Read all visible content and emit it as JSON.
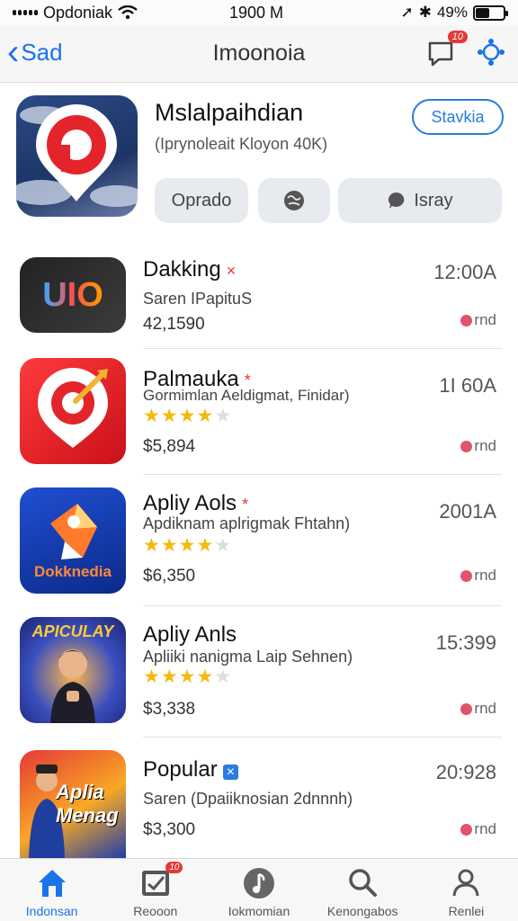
{
  "status": {
    "carrier": "Opdoniak",
    "time": "1900 M",
    "battery": "49%",
    "battery_level": 0.49
  },
  "nav": {
    "back_label": "Sad",
    "title": "Imoonoia",
    "badge": "10"
  },
  "featured": {
    "name": "Mslalpaihdian",
    "subtitle": "(Iprynoleait Kloyon 40K)",
    "get_label": "Stavkia",
    "pill1": "Oprado",
    "pill3": "Isray"
  },
  "apps": [
    {
      "name": "Dakking",
      "mark": "×",
      "subtitle": "Saren IPapituS",
      "price": "42,1590",
      "meta": "12:00A",
      "action": "rnd",
      "rating": null
    },
    {
      "name": "Palmauka",
      "mark": "*",
      "subtitle": "Gormimlan Aeldigmat, Finidar)",
      "price": "$5,894",
      "meta": "1I 60A",
      "action": "rnd",
      "rating": 4
    },
    {
      "name": "Apliy Aols",
      "mark": "*",
      "subtitle": "Apdiknam aplrigmak Fhtahn)",
      "price": "$6,350",
      "meta": "2001A",
      "action": "rnd",
      "rating": 4
    },
    {
      "name": "Apliy Anls",
      "mark": "",
      "subtitle": "Apliiki nanigma Laip Sehnen)",
      "price": "$3,338",
      "meta": "15:399",
      "action": "rnd",
      "rating": 4
    },
    {
      "name": "Popular",
      "mark": "×",
      "subtitle": "Saren (Dpaiiknosian 2dnnnh)",
      "price": "$3,300",
      "meta": "20:928",
      "action": "rnd",
      "rating": null
    }
  ],
  "icon_text": {
    "app1": "UIO",
    "app3": "Dokknedia",
    "app4": "APICULAY",
    "app5": "Aplia Menag"
  },
  "tabs": [
    {
      "label": "Indonsan",
      "icon": "home-icon"
    },
    {
      "label": "Reooon",
      "icon": "checklist-icon",
      "badge": "10"
    },
    {
      "label": "Iokmomian",
      "icon": "music-note-icon"
    },
    {
      "label": "Kenongabos",
      "icon": "search-icon"
    },
    {
      "label": "Renlei",
      "icon": "profile-icon"
    }
  ],
  "colors": {
    "accent": "#1a73e8",
    "badge": "#e53935",
    "star": "#f5b90a",
    "action_dot": "#e0546c"
  }
}
